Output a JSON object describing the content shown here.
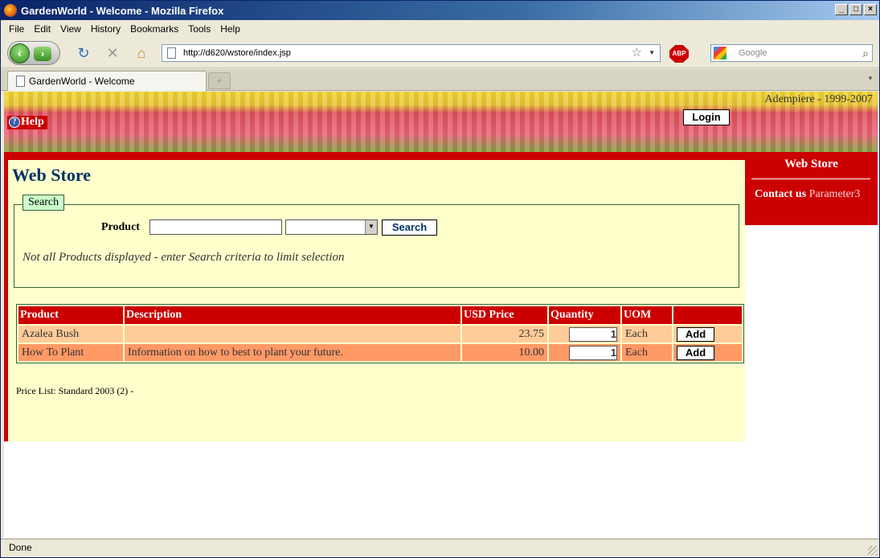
{
  "window": {
    "title": "GardenWorld - Welcome - Mozilla Firefox"
  },
  "menu": [
    "File",
    "Edit",
    "View",
    "History",
    "Bookmarks",
    "Tools",
    "Help"
  ],
  "nav": {
    "url": "http://d620/wstore/index.jsp",
    "search_placeholder": "Google",
    "abp_label": "ABP"
  },
  "tabs": [
    {
      "label": "GardenWorld - Welcome"
    }
  ],
  "banner": {
    "help_label": "Help",
    "copyright": "Adempiere - 1999-2007",
    "login_label": "Login"
  },
  "sidebar": {
    "title": "Web Store",
    "contact_label": "Contact us",
    "contact_param": "Parameter3"
  },
  "main": {
    "title": "Web Store",
    "search": {
      "legend": "Search",
      "product_label": "Product",
      "product_value": "",
      "category_selected": "",
      "button_label": "Search",
      "notice": "Not all Products displayed - enter Search criteria to limit selection"
    },
    "table": {
      "headers": [
        "Product",
        "Description",
        "USD Price",
        "Quantity",
        "UOM",
        ""
      ],
      "rows": [
        {
          "product": "Azalea Bush",
          "description": "",
          "price": "23.75",
          "quantity": "1",
          "uom": "Each",
          "action": "Add"
        },
        {
          "product": "How To Plant",
          "description": "Information on how to best to plant your future.",
          "price": "10.00",
          "quantity": "1",
          "uom": "Each",
          "action": "Add"
        }
      ]
    },
    "price_list": "Price List: Standard 2003 (2) -"
  },
  "status": {
    "text": "Done"
  },
  "colors": {
    "accent_red": "#cc0000",
    "page_bg": "#ffffcc",
    "row1": "#ffcc99",
    "row2": "#ff9966",
    "title_blue": "#003366"
  }
}
